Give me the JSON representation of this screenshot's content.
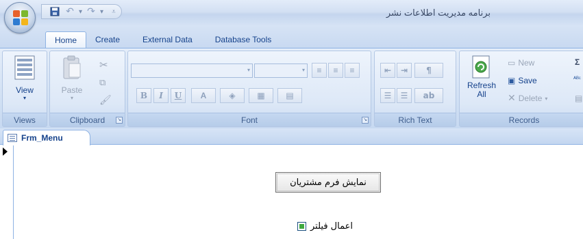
{
  "app": {
    "title": "برنامه مديريت اطلاعات نشر"
  },
  "quick_access": {
    "save_icon": "save-icon",
    "undo_icon": "undo-icon",
    "redo_icon": "redo-icon",
    "customize_icon": "customize-qat-icon"
  },
  "ribbon_tabs": [
    {
      "label": "Home",
      "active": true
    },
    {
      "label": "Create",
      "active": false
    },
    {
      "label": "External Data",
      "active": false
    },
    {
      "label": "Database Tools",
      "active": false
    }
  ],
  "groups": {
    "views": {
      "label": "Views",
      "view_button": "View"
    },
    "clipboard": {
      "label": "Clipboard",
      "paste_button": "Paste"
    },
    "font": {
      "label": "Font",
      "bold": "B",
      "italic": "I",
      "underline": "U",
      "font_color": "A"
    },
    "rich_text": {
      "label": "Rich Text"
    },
    "records": {
      "label": "Records",
      "refresh_label": "Refresh",
      "refresh_sub": "All",
      "new_label": "New",
      "save_label": "Save",
      "delete_label": "Delete"
    }
  },
  "document": {
    "tab_label": "Frm_Menu",
    "show_customers_button": "نمايش فرم مشتريان",
    "filter_label": "اعمال فيلتر"
  },
  "colors": {
    "accent": "#15428b",
    "ribbon": "#d5e3f5",
    "checkbox_fill": "#3fa940"
  }
}
